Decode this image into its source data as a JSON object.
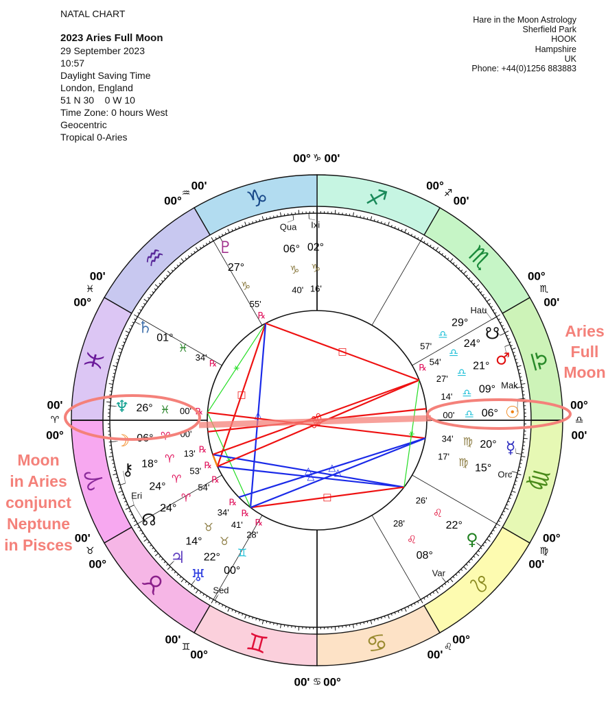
{
  "header": {
    "chart_type": "NATAL CHART",
    "title": "2023 Aries Full Moon",
    "date": "29 September 2023",
    "time": "10:57",
    "dst": "Daylight Saving Time",
    "place": "London, England",
    "coords": "51 N 30    0 W 10",
    "timezone": "Time Zone: 0 hours West",
    "centric": "Geocentric",
    "zodiac": "Tropical 0-Aries"
  },
  "address": {
    "name": "Hare in the Moon Astrology",
    "line1": "Sherfield Park",
    "line2": "HOOK",
    "line3": "Hampshire",
    "line4": "UK",
    "phone": "Phone: +44(0)1256 883883"
  },
  "signs": [
    {
      "name": "Aries",
      "glyph": "♈",
      "fill": "#f7a8f0",
      "color": "#8a2a9a",
      "text_color": "#e0105a"
    },
    {
      "name": "Taurus",
      "glyph": "♉",
      "fill": "#f6b6e6",
      "color": "#8a1f8a",
      "text_color": "#8a7a40"
    },
    {
      "name": "Gemini",
      "glyph": "♊",
      "fill": "#fbd0dc",
      "color": "#e0103a",
      "text_color": "#20c0d8"
    },
    {
      "name": "Cancer",
      "glyph": "♋",
      "fill": "#fde2c6",
      "color": "#9a8a30",
      "text_color": "#8a7a40"
    },
    {
      "name": "Leo",
      "glyph": "♌",
      "fill": "#fdfbb0",
      "color": "#8a8a20",
      "text_color": "#e0103a"
    },
    {
      "name": "Virgo",
      "glyph": "♍",
      "fill": "#e6f8b4",
      "color": "#4a8a1a",
      "text_color": "#8a7a40"
    },
    {
      "name": "Libra",
      "glyph": "♎",
      "fill": "#cdf3b8",
      "color": "#2a8a2a",
      "text_color": "#20c0d8"
    },
    {
      "name": "Scorpio",
      "glyph": "♏",
      "fill": "#c6f5c6",
      "color": "#1a8a3a",
      "text_color": "#e0103a"
    },
    {
      "name": "Sagittarius",
      "glyph": "♐",
      "fill": "#c6f5e2",
      "color": "#1a8a5a",
      "text_color": "#5050c0"
    },
    {
      "name": "Capricorn",
      "glyph": "♑",
      "fill": "#b2dcf0",
      "color": "#1a4a8a",
      "text_color": "#8a7a40"
    },
    {
      "name": "Aquarius",
      "glyph": "♒",
      "fill": "#c8c8f0",
      "color": "#5a2a9a",
      "text_color": "#5050c0"
    },
    {
      "name": "Pisces",
      "glyph": "♓",
      "fill": "#dcc6f4",
      "color": "#6a1a9a",
      "text_color": "#208020"
    }
  ],
  "cusps": [
    {
      "deg": "00°",
      "sign": "♈",
      "min": "00'"
    },
    {
      "deg": "00°",
      "sign": "♉",
      "min": "00'"
    },
    {
      "deg": "00°",
      "sign": "♊",
      "min": "00'"
    },
    {
      "deg": "00°",
      "sign": "♋",
      "min": "00'"
    },
    {
      "deg": "00°",
      "sign": "♌",
      "min": "00'"
    },
    {
      "deg": "00°",
      "sign": "♍",
      "min": "00'"
    },
    {
      "deg": "00°",
      "sign": "♎",
      "min": "00'"
    },
    {
      "deg": "00°",
      "sign": "♏",
      "min": "00'"
    },
    {
      "deg": "00°",
      "sign": "♐",
      "min": "00'"
    },
    {
      "deg": "00°",
      "sign": "♑",
      "min": "00'"
    },
    {
      "deg": "00°",
      "sign": "♒",
      "min": "00'"
    },
    {
      "deg": "00°",
      "sign": "♓",
      "min": "00'"
    }
  ],
  "planets": [
    {
      "name": "Pluto",
      "glyph": "♇",
      "sign": 9,
      "deg": "27°",
      "min": "55'",
      "retro": true,
      "color": "#a0308c"
    },
    {
      "name": "Quaoar",
      "label": "Qua",
      "sign": 9,
      "deg": "06°",
      "min": "40'",
      "retro": false,
      "color": "#111111"
    },
    {
      "name": "Ixion",
      "label": "Ixi",
      "sign": 9,
      "deg": "02°",
      "min": "16'",
      "retro": false,
      "color": "#111111"
    },
    {
      "name": "Saturn",
      "glyph": "♄",
      "sign": 11,
      "deg": "01°",
      "min": "34'",
      "retro": true,
      "color": "#4a78b0"
    },
    {
      "name": "Neptune",
      "glyph": "♆",
      "sign": 11,
      "deg": "26°",
      "min": "00'",
      "retro": true,
      "color": "#10a090"
    },
    {
      "name": "Moon",
      "glyph": "☽",
      "sign": 0,
      "deg": "06°",
      "min": "00'",
      "retro": false,
      "color": "#f08010"
    },
    {
      "name": "Chiron",
      "glyph": "⚷",
      "sign": 0,
      "deg": "18°",
      "min": "13'",
      "retro": true,
      "color": "#111111"
    },
    {
      "name": "Eris",
      "label": "Eri",
      "sign": 0,
      "deg": "24°",
      "min": "53'",
      "retro": true,
      "color": "#111111"
    },
    {
      "name": "North Node",
      "glyph": "☊",
      "sign": 0,
      "deg": "24°",
      "min": "54'",
      "retro": true,
      "color": "#111111"
    },
    {
      "name": "Jupiter",
      "glyph": "♃",
      "sign": 1,
      "deg": "14°",
      "min": "34'",
      "retro": true,
      "color": "#6040c0"
    },
    {
      "name": "Uranus",
      "glyph": "♅",
      "sign": 1,
      "deg": "22°",
      "min": "41'",
      "retro": true,
      "color": "#3040e0"
    },
    {
      "name": "Sedna",
      "label": "Sed",
      "sign": 2,
      "deg": "00°",
      "min": "28'",
      "retro": true,
      "color": "#111111"
    },
    {
      "name": "Varuna",
      "label": "Var",
      "sign": 4,
      "deg": "08°",
      "min": "28'",
      "retro": false,
      "color": "#111111"
    },
    {
      "name": "Venus",
      "glyph": "♀",
      "sign": 4,
      "deg": "22°",
      "min": "26'",
      "retro": false,
      "color": "#208020"
    },
    {
      "name": "Orcus",
      "label": "Orc",
      "sign": 5,
      "deg": "15°",
      "min": "17'",
      "retro": false,
      "color": "#111111"
    },
    {
      "name": "Mercury",
      "glyph": "☿",
      "sign": 5,
      "deg": "20°",
      "min": "34'",
      "retro": false,
      "color": "#3030c0"
    },
    {
      "name": "Sun",
      "glyph": "☉",
      "sign": 6,
      "deg": "06°",
      "min": "00'",
      "retro": false,
      "color": "#f08010"
    },
    {
      "name": "Makemake",
      "label": "Mak",
      "sign": 6,
      "deg": "09°",
      "min": "14'",
      "retro": false,
      "color": "#111111"
    },
    {
      "name": "Mars",
      "glyph": "♂",
      "sign": 6,
      "deg": "21°",
      "min": "27'",
      "retro": false,
      "color": "#e01010"
    },
    {
      "name": "South Node",
      "glyph": "☋",
      "sign": 6,
      "deg": "24°",
      "min": "54'",
      "retro": true,
      "color": "#111111"
    },
    {
      "name": "Haumea",
      "label": "Hau",
      "sign": 6,
      "deg": "29°",
      "min": "57'",
      "retro": false,
      "color": "#111111"
    }
  ],
  "retro_symbol": "℞",
  "retro_color": "#e0105a",
  "aspect_types": [
    {
      "name": "conjunction",
      "symbol": "☌",
      "color": "#f08010"
    },
    {
      "name": "opposition",
      "symbol": "☍",
      "color": "#ee1111"
    },
    {
      "name": "square",
      "symbol": "□",
      "color": "#ee1111"
    },
    {
      "name": "trine",
      "symbol": "△",
      "color": "#1a2ae8"
    },
    {
      "name": "sextile",
      "symbol": "⚹",
      "color": "#22dd22"
    }
  ],
  "annotations": {
    "color": "#f4817a",
    "right": [
      "Aries",
      "Full",
      "Moon"
    ],
    "left": [
      "Moon",
      "in Aries",
      "conjunct",
      "Neptune",
      "in Pisces"
    ]
  }
}
